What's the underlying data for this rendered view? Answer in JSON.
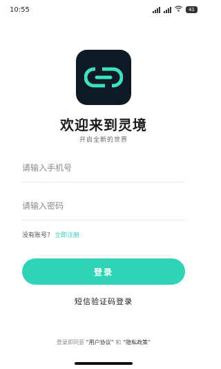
{
  "status_bar": {
    "time": "10:55",
    "battery": "41"
  },
  "app": {
    "logo_icon": "link-chain-icon",
    "title": "欢迎来到灵境",
    "subtitle": "开启全新的世界"
  },
  "form": {
    "phone_placeholder": "请输入手机号",
    "password_placeholder": "请输入密码",
    "no_account_text": "没有账号？",
    "register_link": "立即注册",
    "login_label": "登录",
    "sms_login_label": "短信验证码登录"
  },
  "agreement": {
    "prefix": "登录即同意",
    "user_agreement": "“用户协议”",
    "and": "和",
    "privacy_policy": "“隐私政策”"
  },
  "colors": {
    "accent": "#2fd4b6",
    "logo_bg": "#0e1b24"
  }
}
